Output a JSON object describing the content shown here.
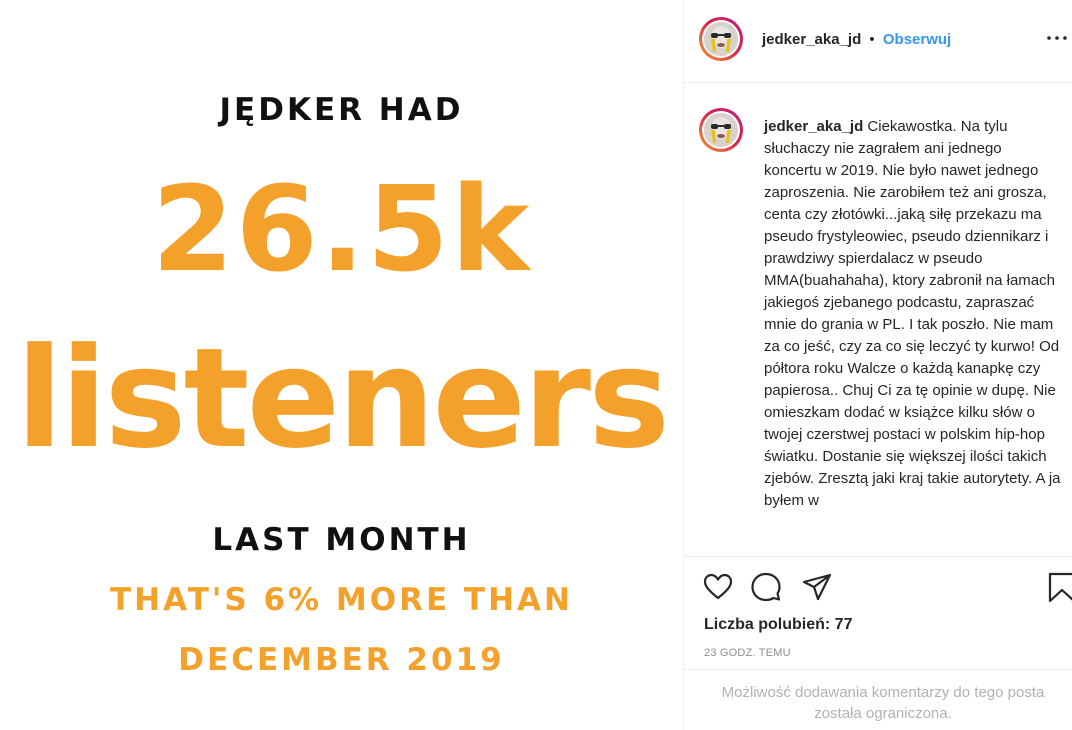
{
  "image": {
    "heading": "JĘDKER HAD",
    "big_number": "26.5k",
    "big_word": "listeners",
    "subheading": "LAST MONTH",
    "caption_line1": "THAT'S 6% MORE THAN",
    "caption_line2": "DECEMBER 2019",
    "colors": {
      "accent": "#f4a12c",
      "dark_text": "#111111"
    }
  },
  "post": {
    "username": "jedker_aka_jd",
    "separator": "•",
    "follow_label": "Obserwuj",
    "more_icon": "more-options-icon",
    "caption_username": "jedker_aka_jd",
    "caption_text": "Ciekawostka. Na tylu słuchaczy nie zagrałem ani jednego koncertu w 2019. Nie było nawet jednego zaproszenia. Nie zarobiłem też ani grosza, centa czy złotówki...jaką siłę przekazu ma pseudo frystyleowiec, pseudo dziennikarz i prawdziwy spierdalacz w pseudo MMA(buahahaha), ktory zabronił na łamach jakiegoś zjebanego podcastu, zapraszać mnie do grania w PL. I tak poszło. Nie mam za co jeść, czy za co się leczyć ty kurwo! Od półtora roku Walcze o każdą kanapkę czy papierosa.. Chuj Ci za tę opinie w dupę. Nie omieszkam dodać w książce kilku słów o twojej czerstwej postaci w polskim hip-hop światku. Dostanie się większej ilości takich zjebów. Zresztą jaki kraj takie autorytety. A ja byłem w",
    "likes_text": "Liczba polubień: 77",
    "timestamp": "23 GODZ. TEMU",
    "comments_limited": "Możliwość dodawania komentarzy do tego posta została ograniczona.",
    "icons": [
      "heart-icon",
      "comment-icon",
      "share-icon",
      "save-icon"
    ],
    "colors": {
      "link": "#3897f0",
      "text": "#262626",
      "muted": "#8e8e8e"
    }
  }
}
